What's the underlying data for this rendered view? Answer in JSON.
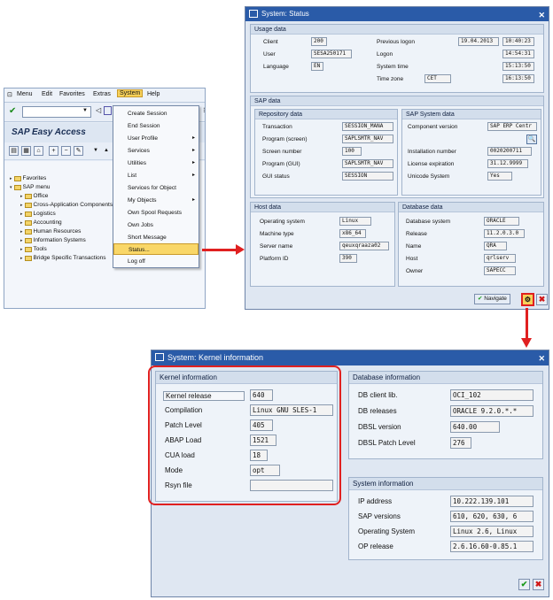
{
  "main": {
    "menu": [
      "Menu",
      "Edit",
      "Favorites",
      "Extras",
      "System",
      "Help"
    ],
    "title": "SAP Easy Access",
    "tree": [
      "Favorites",
      "SAP menu",
      "Office",
      "Cross-Application Components",
      "Logistics",
      "Accounting",
      "Human Resources",
      "Information Systems",
      "Tools",
      "Bridge Specific Transactions"
    ]
  },
  "system_menu": {
    "items": [
      "Create Session",
      "End Session",
      "User Profile",
      "Services",
      "Utilities",
      "List",
      "Services for Object",
      "My Objects",
      "Own Spool Requests",
      "Own Jobs",
      "Short Message",
      "Status...",
      "Log off"
    ],
    "arrow": "▸"
  },
  "status": {
    "title": "System: Status",
    "usage": {
      "header": "Usage data",
      "client_label": "Client",
      "client": "200",
      "user_label": "User",
      "user": "SESA250171",
      "language_label": "Language",
      "language": "EN",
      "prev_logon_label": "Previous logon",
      "prev_logon_date": "19.04.2013",
      "prev_logon_time": "10:40:23",
      "logon_label": "Logon",
      "logon_time": "14:54:31",
      "system_time_label": "System time",
      "system_time": "15:13:50",
      "time_zone_label": "Time zone",
      "time_zone": "CET",
      "time_zone_time": "16:13:50"
    },
    "sap_data": {
      "header": "SAP data",
      "repo_header": "Repository data",
      "transaction_label": "Transaction",
      "transaction": "SESSION_MANA",
      "program_screen_label": "Program (screen)",
      "program_screen": "SAPLSMTR_NAV",
      "screen_number_label": "Screen number",
      "screen_number": "100",
      "program_gui_label": "Program (GUI)",
      "program_gui": "SAPLSMTR_NAV",
      "gui_status_label": "GUI status",
      "gui_status": "SESSION",
      "sys_header": "SAP System data",
      "component_label": "Component version",
      "component": "SAP ERP Centr",
      "install_label": "Installation number",
      "install": "0020200711",
      "license_label": "License expiration",
      "license": "31.12.9999",
      "unicode_label": "Unicode System",
      "unicode": "Yes"
    },
    "host": {
      "header": "Host data",
      "os_label": "Operating system",
      "os": "Linux",
      "machine_label": "Machine type",
      "machine": "x86_64",
      "server_label": "Server name",
      "server": "qeuxqraaza02",
      "platform_label": "Platform ID",
      "platform": "390"
    },
    "db": {
      "header": "Database data",
      "system_label": "Database system",
      "system": "ORACLE",
      "release_label": "Release",
      "release": "11.2.0.3.0",
      "name_label": "Name",
      "name": "QRA",
      "host_label": "Host",
      "host": "qrlserv",
      "owner_label": "Owner",
      "owner": "SAPECC"
    },
    "navigate_label": "Navigate"
  },
  "kernel": {
    "title": "System: Kernel information",
    "kernel_info": {
      "header": "Kernel information",
      "release_label": "Kernel release",
      "release": "640",
      "compilation_label": "Compilation",
      "compilation": "Linux GNU SLES-1",
      "patch_label": "Patch Level",
      "patch": "405",
      "abap_label": "ABAP Load",
      "abap": "1521",
      "cua_label": "CUA load",
      "cua": "18",
      "mode_label": "Mode",
      "mode": "opt",
      "rsyn_label": "Rsyn file",
      "rsyn": ""
    },
    "db_info": {
      "header": "Database information",
      "client_lib_label": "DB client lib.",
      "client_lib": "OCI_102",
      "releases_label": "DB releases",
      "releases": "ORACLE 9.2.0.*.*",
      "dbsl_label": "DBSL version",
      "dbsl": "640.00",
      "dbsl_patch_label": "DBSL Patch Level",
      "dbsl_patch": "276"
    },
    "sys_info": {
      "header": "System information",
      "ip_label": "IP address",
      "ip": "10.222.139.101",
      "sap_versions_label": "SAP versions",
      "sap_versions": "610, 620, 630, 6",
      "os_label": "Operating System",
      "os": "Linux 2.6, Linux",
      "op_release_label": "OP release",
      "op_release": "2.6.16.60-0.85.1"
    }
  },
  "colors": {
    "accent_red": "#e02020",
    "title_blue": "#2a5ba8",
    "highlight": "#f9d768"
  }
}
